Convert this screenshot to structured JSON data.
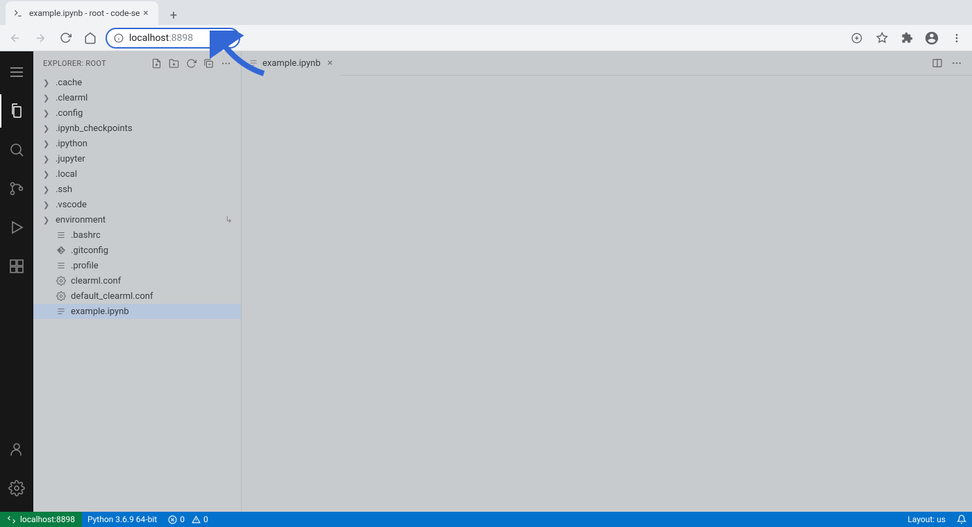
{
  "browser": {
    "tab_title": "example.ipynb - root - code-se",
    "address_host": "localhost",
    "address_port": ":8898"
  },
  "activity": {
    "menu": "menu",
    "explorer": "explorer",
    "search": "search",
    "scm": "source-control",
    "run": "run-debug",
    "extensions": "extensions",
    "account": "account",
    "settings": "settings"
  },
  "sidebar": {
    "title": "EXPLORER: ROOT",
    "folders": [
      {
        "name": ".cache"
      },
      {
        "name": ".clearml"
      },
      {
        "name": ".config"
      },
      {
        "name": ".ipynb_checkpoints"
      },
      {
        "name": ".ipython"
      },
      {
        "name": ".jupyter"
      },
      {
        "name": ".local"
      },
      {
        "name": ".ssh"
      },
      {
        "name": ".vscode"
      },
      {
        "name": "environment",
        "symlink": true
      }
    ],
    "files": [
      {
        "name": ".bashrc",
        "icon": "lines"
      },
      {
        "name": ".gitconfig",
        "icon": "git"
      },
      {
        "name": ".profile",
        "icon": "lines"
      },
      {
        "name": "clearml.conf",
        "icon": "gear"
      },
      {
        "name": "default_clearml.conf",
        "icon": "gear"
      },
      {
        "name": "example.ipynb",
        "icon": "nb",
        "selected": true
      }
    ]
  },
  "editor": {
    "tab_label": "example.ipynb"
  },
  "status": {
    "remote": "localhost:8898",
    "python": "Python 3.6.9 64-bit",
    "errors": "0",
    "warnings": "0",
    "layout": "Layout: us"
  }
}
